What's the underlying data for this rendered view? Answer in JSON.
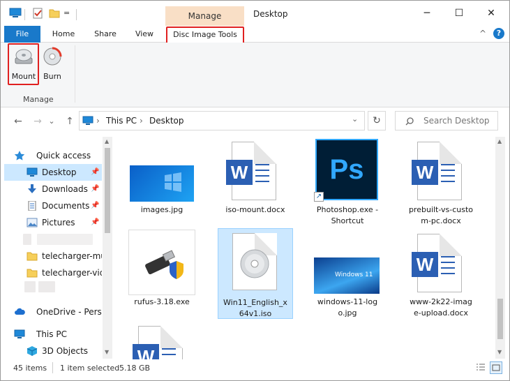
{
  "window": {
    "title": "Desktop",
    "contextual_group": "Manage",
    "controls": {
      "minimize": "─",
      "maximize": "☐",
      "close": "✕"
    },
    "quick_access_sep": "="
  },
  "tabs": [
    {
      "label": "File"
    },
    {
      "label": "Home"
    },
    {
      "label": "Share"
    },
    {
      "label": "View"
    },
    {
      "label": "Disc Image Tools"
    }
  ],
  "ribbon": {
    "buttons": [
      {
        "label": "Mount"
      },
      {
        "label": "Burn"
      }
    ],
    "group_label": "Manage",
    "collapse": "^",
    "help": "?"
  },
  "address": {
    "back": "←",
    "forward": "→",
    "dropdown": "⌄",
    "up": "↑",
    "crumbs": [
      "This PC",
      "Desktop"
    ],
    "separator": "›",
    "refresh": "↻",
    "search_placeholder": "Search Desktop"
  },
  "nav_pane": {
    "items": [
      {
        "label": "Quick access"
      },
      {
        "label": "Desktop",
        "pinned": true
      },
      {
        "label": "Downloads",
        "pinned": true
      },
      {
        "label": "Documents",
        "pinned": true
      },
      {
        "label": "Pictures",
        "pinned": true
      },
      {
        "label": "telecharger-mus"
      },
      {
        "label": "telecharger-vide"
      },
      {
        "label": "OneDrive - Person"
      },
      {
        "label": "This PC"
      },
      {
        "label": "3D Objects"
      }
    ]
  },
  "files": [
    {
      "name": "images.jpg"
    },
    {
      "name": "iso-mount.docx"
    },
    {
      "name": "Photoshop.exe - Shortcut"
    },
    {
      "name": "prebuilt-vs-custom-pc.docx"
    },
    {
      "name": "rufus-3.18.exe"
    },
    {
      "name": "Win11_English_x64v1.iso"
    },
    {
      "name": "windows-11-logo.jpg"
    },
    {
      "name": "www-2k22-image-upload.docx"
    }
  ],
  "file_lines": {
    "photoshop": [
      "Photoshop.exe -",
      "Shortcut"
    ],
    "prebuilt": [
      "prebuilt-vs-custo",
      "m-pc.docx"
    ],
    "win11": [
      "Win11_English_x",
      "64v1.iso"
    ],
    "w11logo": [
      "windows-11-log",
      "o.jpg"
    ],
    "www": [
      "www-2k22-imag",
      "e-upload.docx"
    ]
  },
  "thumb_text": {
    "photoshop": "Ps",
    "word": "W",
    "windows11": "Windows 11"
  },
  "status": {
    "items_count": "45 items",
    "selection": "1 item selected",
    "size": "5.18 GB"
  },
  "colors": {
    "accent": "#1979ca",
    "selection": "#cce8ff",
    "highlight": "#e02020",
    "context_tab": "#f9dfc6",
    "photoshop_bg": "#001e36",
    "photoshop_fg": "#31a8ff",
    "word_blue": "#2b5fb3"
  }
}
